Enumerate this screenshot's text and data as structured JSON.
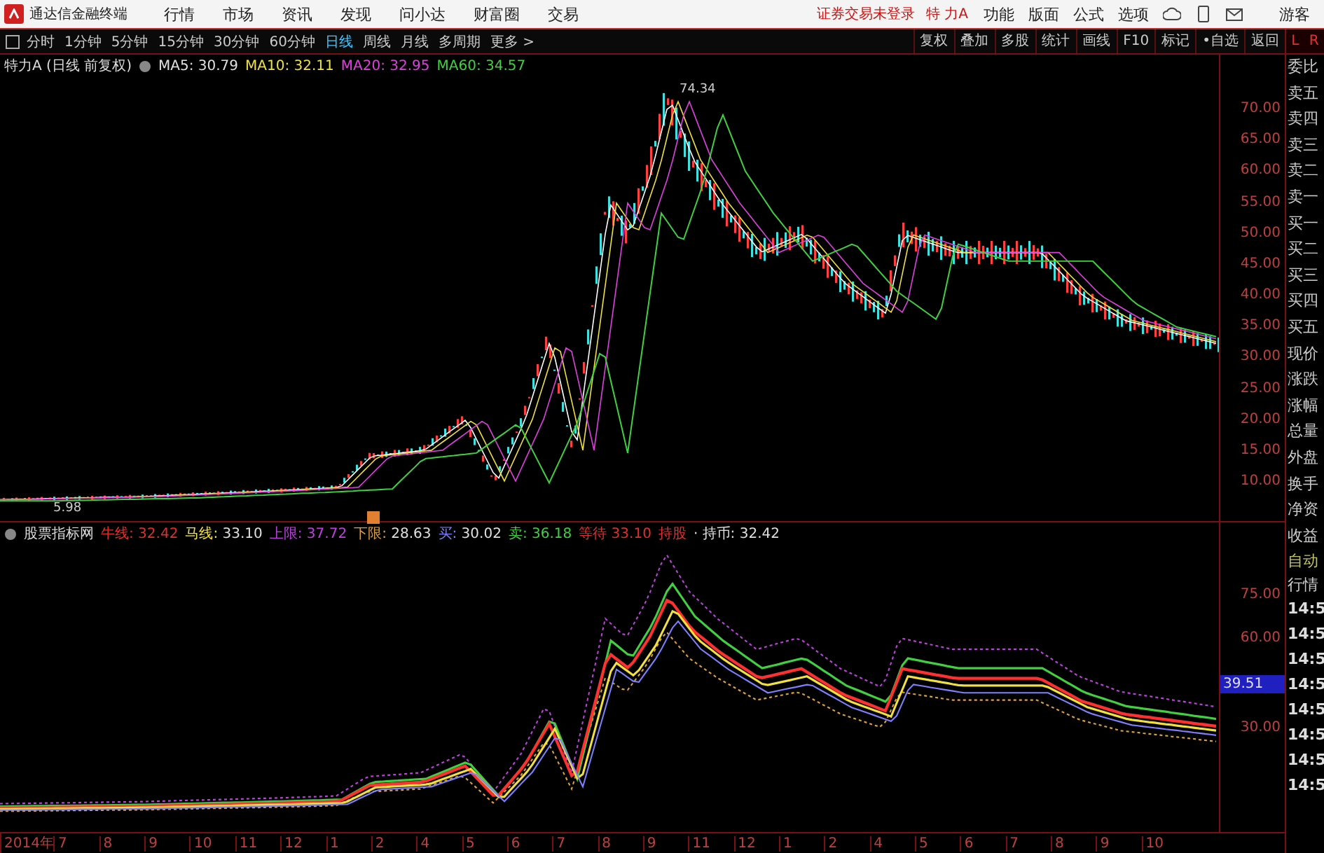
{
  "top_bar": {
    "app_title": "通达信金融终端",
    "menu": [
      "行情",
      "市场",
      "资讯",
      "发现",
      "问小达",
      "财富圈",
      "交易"
    ],
    "login_status": "证券交易未登录",
    "stock_name": "特 力A",
    "right_menu": [
      "功能",
      "版面",
      "公式",
      "选项"
    ],
    "user": "游客"
  },
  "toolbar": {
    "periods": [
      {
        "label": "分时",
        "selected": false
      },
      {
        "label": "1分钟",
        "selected": false
      },
      {
        "label": "5分钟",
        "selected": false
      },
      {
        "label": "15分钟",
        "selected": false
      },
      {
        "label": "30分钟",
        "selected": false
      },
      {
        "label": "60分钟",
        "selected": false
      },
      {
        "label": "日线",
        "selected": true
      },
      {
        "label": "周线",
        "selected": false
      },
      {
        "label": "月线",
        "selected": false
      },
      {
        "label": "多周期",
        "selected": false
      }
    ],
    "more": "更多 >",
    "tools": [
      "复权",
      "叠加",
      "多股",
      "统计",
      "画线",
      "F10",
      "标记",
      "•自选",
      "返回"
    ]
  },
  "side_tabs": [
    "L",
    "R"
  ],
  "price_panel": {
    "title": "特力A (日线 前复权)",
    "indicators": [
      {
        "label": "MA5: 30.79",
        "color": "#e0e0e0"
      },
      {
        "label": "MA10: 32.11",
        "color": "#f0e040"
      },
      {
        "label": "MA20: 32.95",
        "color": "#e040e0"
      },
      {
        "label": "MA60: 34.57",
        "color": "#40d040"
      }
    ],
    "y_ticks": [
      "70.00",
      "65.00",
      "60.00",
      "55.00",
      "50.00",
      "45.00",
      "40.00",
      "35.00",
      "30.00",
      "25.00",
      "20.00",
      "15.00",
      "10.00"
    ],
    "high_label": "74.34",
    "low_label": "5.98"
  },
  "indicator_panel": {
    "title": "股票指标网",
    "values": [
      {
        "name": "牛线:",
        "color": "#e03030",
        "reading": {
          "text": "32.42",
          "color": "#e03030"
        }
      },
      {
        "name": "马线:",
        "color": "#f0e040",
        "reading": {
          "text": "33.10",
          "color": "#e0e0e0"
        }
      },
      {
        "name": "上限:",
        "color": "#c040e0",
        "reading": {
          "text": "37.72",
          "color": "#c040e0"
        }
      },
      {
        "name": "下限:",
        "color": "#e0a040",
        "reading": {
          "text": "28.63",
          "color": "#e0e0e0"
        }
      },
      {
        "name": "买:",
        "color": "#8080ff",
        "reading": {
          "text": "30.02",
          "color": "#e0e0e0"
        }
      },
      {
        "name": "卖:",
        "color": "#40d040",
        "reading": {
          "text": "36.18",
          "color": "#40d040"
        }
      },
      {
        "name": "等待",
        "color": "#e03030",
        "reading": {
          "text": "33.10",
          "color": "#e03030"
        }
      },
      {
        "name": "持股",
        "color": "#e03030"
      },
      {
        "name": "· 持币:",
        "color": "#e0e0e0",
        "reading": {
          "text": "32.42",
          "color": "#e0e0e0"
        }
      }
    ],
    "y_ticks": [
      "75.00",
      "60.00",
      "30.00"
    ],
    "cursor_value": "39.51"
  },
  "x_axis": [
    "2014年",
    "7",
    "8",
    "9",
    "10",
    "11",
    "12",
    "1",
    "2",
    "4",
    "5",
    "6",
    "7",
    "8",
    "9",
    "11",
    "12",
    "1",
    "2",
    "4",
    "5",
    "6",
    "7",
    "8",
    "9",
    "10"
  ],
  "quote_labels": [
    "委比",
    "卖五",
    "卖四",
    "卖三",
    "卖二",
    "卖一",
    "买一",
    "买二",
    "买三",
    "买四",
    "买五",
    "现价",
    "涨跌",
    "涨幅",
    "总量",
    "外盘",
    "换手",
    "净资",
    "收益"
  ],
  "auto_quote": [
    "自动",
    "行情"
  ],
  "tick_times": [
    "14:5",
    "14:5",
    "14:5",
    "14:5",
    "14:5",
    "14:5",
    "14:5",
    "14:5"
  ]
}
